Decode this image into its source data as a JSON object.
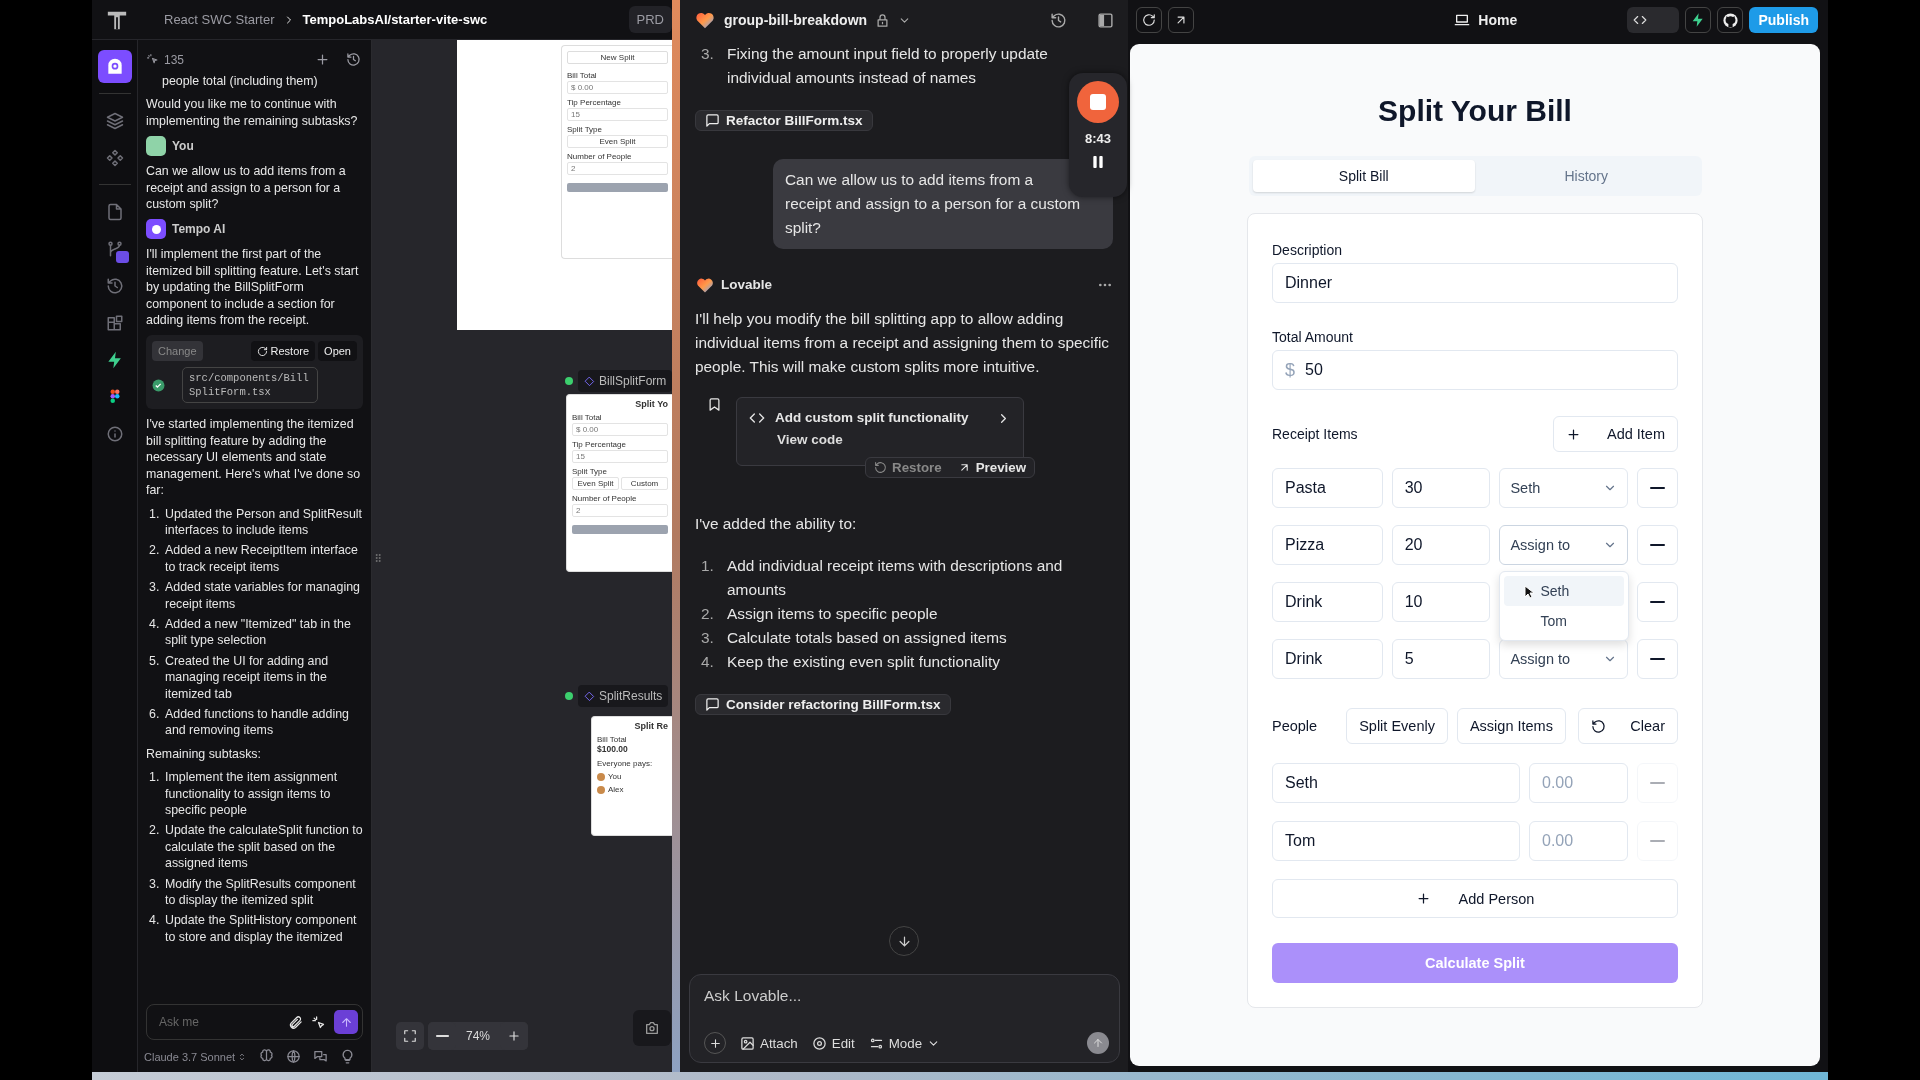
{
  "tempo": {
    "breadcrumb": {
      "project": "React SWC Starter",
      "repo": "TempoLabsAI/starter-vite-swc"
    },
    "prd_button": "PRD",
    "rail": [
      {
        "kind": "assistant",
        "selected": true
      },
      {
        "kind": "layers",
        "selected": false
      },
      {
        "kind": "components",
        "selected": false
      },
      {
        "kind": "file",
        "selected": false
      },
      {
        "kind": "git",
        "selected": false
      },
      {
        "kind": "history",
        "selected": false
      },
      {
        "kind": "grid",
        "selected": false
      },
      {
        "kind": "bolt",
        "selected": false
      },
      {
        "kind": "figma",
        "selected": false
      },
      {
        "kind": "info",
        "selected": false
      }
    ],
    "chat": {
      "count": "135",
      "blocks": [
        {
          "kind": "continuation",
          "text": "people total (including them)"
        },
        {
          "kind": "text",
          "text": "Would you like me to continue with implementing the remaining subtasks?"
        },
        {
          "kind": "user_author",
          "name": "You"
        },
        {
          "kind": "text",
          "text": "Can we allow us to add items from a receipt and assign to a person for a custom split?"
        },
        {
          "kind": "ai_author",
          "name": "Tempo AI"
        },
        {
          "kind": "text",
          "text": "I'll implement the first part of the itemized bill splitting feature. Let's start by updating the BillSplitForm component to include a section for adding items from the receipt."
        },
        {
          "kind": "file_card",
          "change": "Change",
          "change_disabled": true,
          "restore": "Restore",
          "open": "Open",
          "path": "src/components/BillSplitForm.tsx"
        },
        {
          "kind": "text",
          "text": "I've started implementing the itemized bill splitting feature by adding the necessary UI elements and state management. Here's what I've done so far:"
        },
        {
          "kind": "list",
          "items": [
            {
              "num": "1.",
              "text": "Updated the Person and SplitResult interfaces to include items"
            },
            {
              "num": "2.",
              "text": "Added a new ReceiptItem interface to track receipt items"
            },
            {
              "num": "3.",
              "text": "Added state variables for managing receipt items"
            },
            {
              "num": "4.",
              "text": "Added a new \"Itemized\" tab in the split type selection"
            },
            {
              "num": "5.",
              "text": "Created the UI for adding and managing receipt items in the itemized tab"
            },
            {
              "num": "6.",
              "text": "Added functions to handle adding and removing items"
            }
          ]
        },
        {
          "kind": "text",
          "text": "Remaining subtasks:"
        },
        {
          "kind": "list",
          "items": [
            {
              "num": "1.",
              "text": "Implement the item assignment functionality to assign items to specific people"
            },
            {
              "num": "2.",
              "text": "Update the calculateSplit function to calculate the split based on the assigned items"
            },
            {
              "num": "3.",
              "text": "Modify the SplitResults component to display the itemized split"
            },
            {
              "num": "4.",
              "text": "Update the SplitHistory component to store and display the itemized"
            }
          ]
        }
      ],
      "placeholder": "Ask me",
      "model": "Claude 3.7 Sonnet"
    },
    "canvas": {
      "frames": [
        {
          "kind": "page",
          "tab": "New Split",
          "fields": [
            {
              "label": "Bill Total",
              "prefix": "$",
              "value": "0.00"
            },
            {
              "label": "Tip Percentage",
              "value": "15"
            },
            {
              "label": "Split Type",
              "options": [
                "Even Split"
              ]
            },
            {
              "label": "Number of People",
              "value": "2"
            }
          ]
        },
        {
          "kind": "form",
          "label": "BillSplitForm",
          "title": "Split Yo",
          "fields": [
            {
              "label": "Bill Total",
              "prefix": "$",
              "value": "0.00"
            },
            {
              "label": "Tip Percentage",
              "value": "15"
            },
            {
              "label": "Split Type",
              "options": [
                "Even Split",
                "Custom"
              ]
            },
            {
              "label": "Number of People",
              "value": "2"
            }
          ]
        },
        {
          "kind": "results",
          "label": "SplitResults",
          "title": "Split Re",
          "stat_label": "Bill Total",
          "stat_value": "$100.00",
          "section": "Everyone pays:",
          "people": [
            "You",
            "Alex"
          ]
        }
      ],
      "zoom": "74%"
    }
  },
  "lovable": {
    "project": "group-bill-breakdown",
    "blocks": [
      {
        "kind": "list",
        "items": [
          {
            "num": "3.",
            "text": "Fixing the amount input field to properly update individual amounts instead of names"
          }
        ]
      },
      {
        "kind": "chip",
        "text": "Refactor BillForm.tsx"
      },
      {
        "kind": "user",
        "text": "Can we allow us to add items from a receipt and assign to a person for a custom split?"
      },
      {
        "kind": "author",
        "name": "Lovable"
      },
      {
        "kind": "text",
        "text": "I'll help you modify the bill splitting app to allow adding individual items from a receipt and assigning them to specific people. This will make custom splits more intuitive."
      },
      {
        "kind": "commit",
        "title": "Add custom split functionality",
        "link": "View code",
        "restore": "Restore",
        "preview": "Preview"
      },
      {
        "kind": "text",
        "text": "I've added the ability to:"
      },
      {
        "kind": "list",
        "items": [
          {
            "num": "1.",
            "text": "Add individual receipt items with descriptions and amounts"
          },
          {
            "num": "2.",
            "text": "Assign items to specific people"
          },
          {
            "num": "3.",
            "text": "Calculate totals based on assigned items"
          },
          {
            "num": "4.",
            "text": "Keep the existing even split functionality"
          }
        ]
      },
      {
        "kind": "chip",
        "text": "Consider refactoring BillForm.tsx"
      }
    ],
    "recorder": {
      "time": "8:43"
    },
    "input": {
      "placeholder": "Ask Lovable...",
      "attach": "Attach",
      "edit": "Edit",
      "mode": "Mode"
    }
  },
  "preview": {
    "route": "Home",
    "code_view_on": false,
    "publish": "Publish",
    "app": {
      "title": "Split Your Bill",
      "tabs": [
        {
          "label": "Split Bill",
          "selected": true
        },
        {
          "label": "History",
          "selected": false
        }
      ],
      "description": {
        "label": "Description",
        "value": "Dinner"
      },
      "total": {
        "label": "Total Amount",
        "currency": "$",
        "value": "50"
      },
      "receipt": {
        "label": "Receipt Items",
        "add": "Add Item",
        "items": [
          {
            "name": "Pasta",
            "amount": "30",
            "select": "Seth",
            "open": false
          },
          {
            "name": "Pizza",
            "amount": "20",
            "select": "Assign to",
            "open": true
          },
          {
            "name": "Drink",
            "amount": "10",
            "open": false
          },
          {
            "name": "Drink",
            "amount": "5",
            "select": "Assign to",
            "open": false
          }
        ],
        "options": [
          {
            "label": "Seth",
            "selected": true
          },
          {
            "label": "Tom",
            "selected": false
          }
        ]
      },
      "people": {
        "label": "People",
        "modes": [
          "Split Evenly",
          "Assign Items"
        ],
        "clear": "Clear",
        "rows": [
          {
            "name": "Seth",
            "placeholder": "0.00",
            "remove_disabled": true
          },
          {
            "name": "Tom",
            "placeholder": "0.00",
            "remove_disabled": true
          }
        ],
        "add": "Add Person"
      },
      "calculate": {
        "label": "Calculate Split",
        "disabled": true
      }
    }
  }
}
